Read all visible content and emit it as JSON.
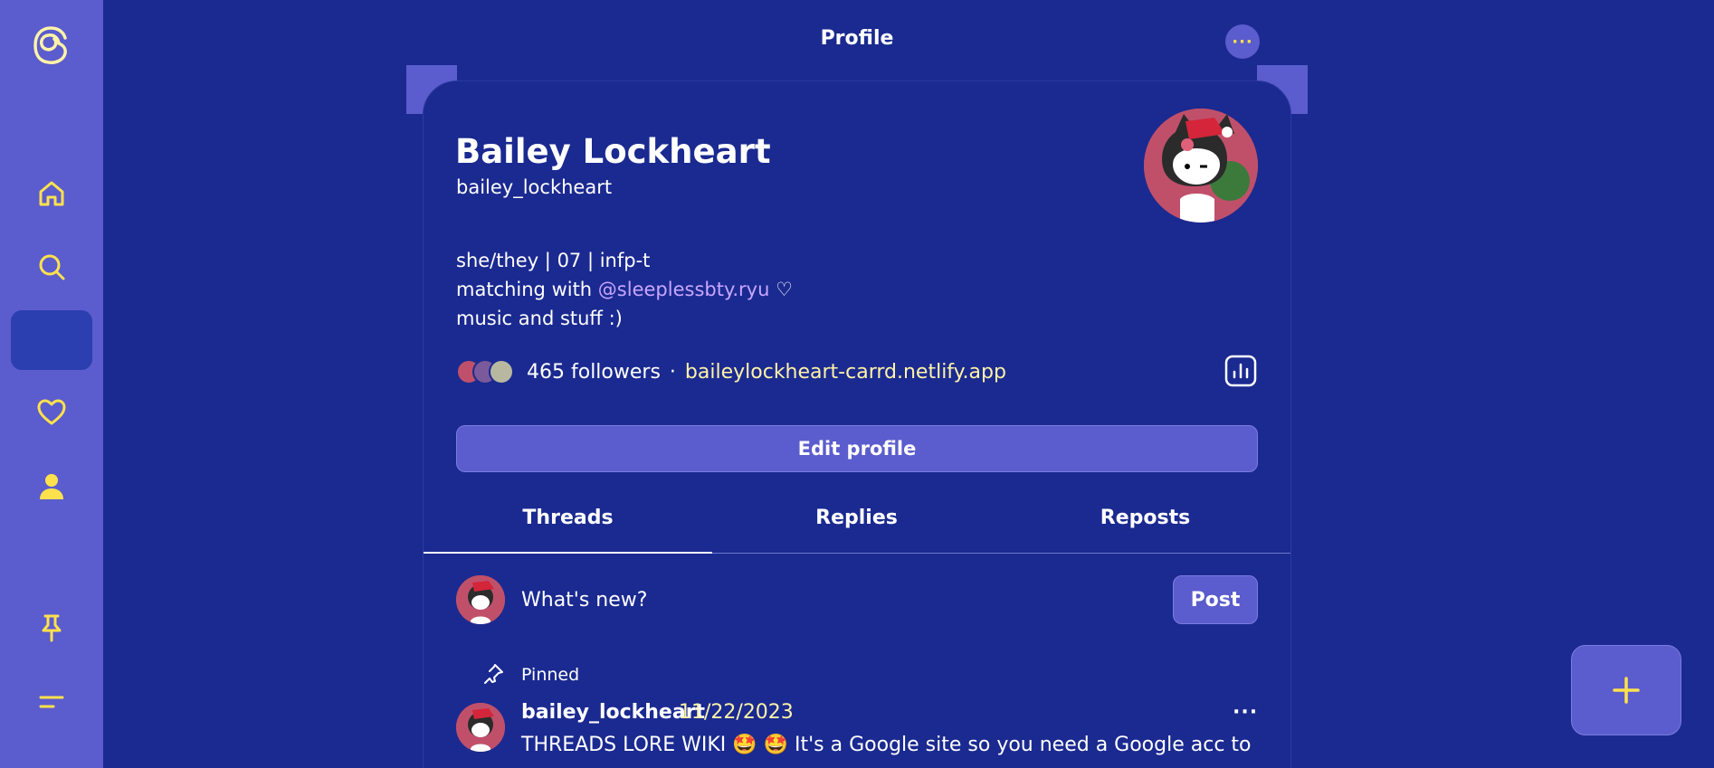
{
  "colors": {
    "background": "#1b2a90",
    "sidebar": "#5b5ccd",
    "accent": "#ffe14d",
    "link": "#fff3a8",
    "mention": "#c8a6ff"
  },
  "sidebar": {
    "items": [
      {
        "icon": "threads-logo-icon"
      },
      {
        "icon": "home-icon"
      },
      {
        "icon": "search-icon"
      },
      {
        "icon": "create-icon",
        "active": true
      },
      {
        "icon": "heart-icon"
      },
      {
        "icon": "profile-icon"
      },
      {
        "icon": "pin-icon"
      },
      {
        "icon": "menu-icon"
      }
    ]
  },
  "header": {
    "title": "Profile",
    "more_label": "···"
  },
  "profile": {
    "name": "Bailey Lockheart",
    "handle": "bailey_lockheart",
    "bio_line1": "she/they | 07 | infp-t",
    "bio_line2_prefix": "matching with ",
    "bio_line2_mention": "@sleeplessbty.ryu",
    "bio_line2_suffix": " ♡",
    "bio_line3": "music and stuff :)",
    "followers": "465 followers",
    "separator": "·",
    "link": "baileylockheart-carrd.netlify.app",
    "edit_label": "Edit profile"
  },
  "tabs": [
    {
      "label": "Threads",
      "active": true
    },
    {
      "label": "Replies"
    },
    {
      "label": "Reposts"
    }
  ],
  "composer": {
    "placeholder": "What's new?",
    "post_label": "Post"
  },
  "pinned_label": "Pinned",
  "post": {
    "username": "bailey_lockheart",
    "date": "11/22/2023",
    "more_label": "···",
    "text": "THREADS LORE WIKI 🤩 🤩  It's a Google site so you need a Google acc to"
  }
}
